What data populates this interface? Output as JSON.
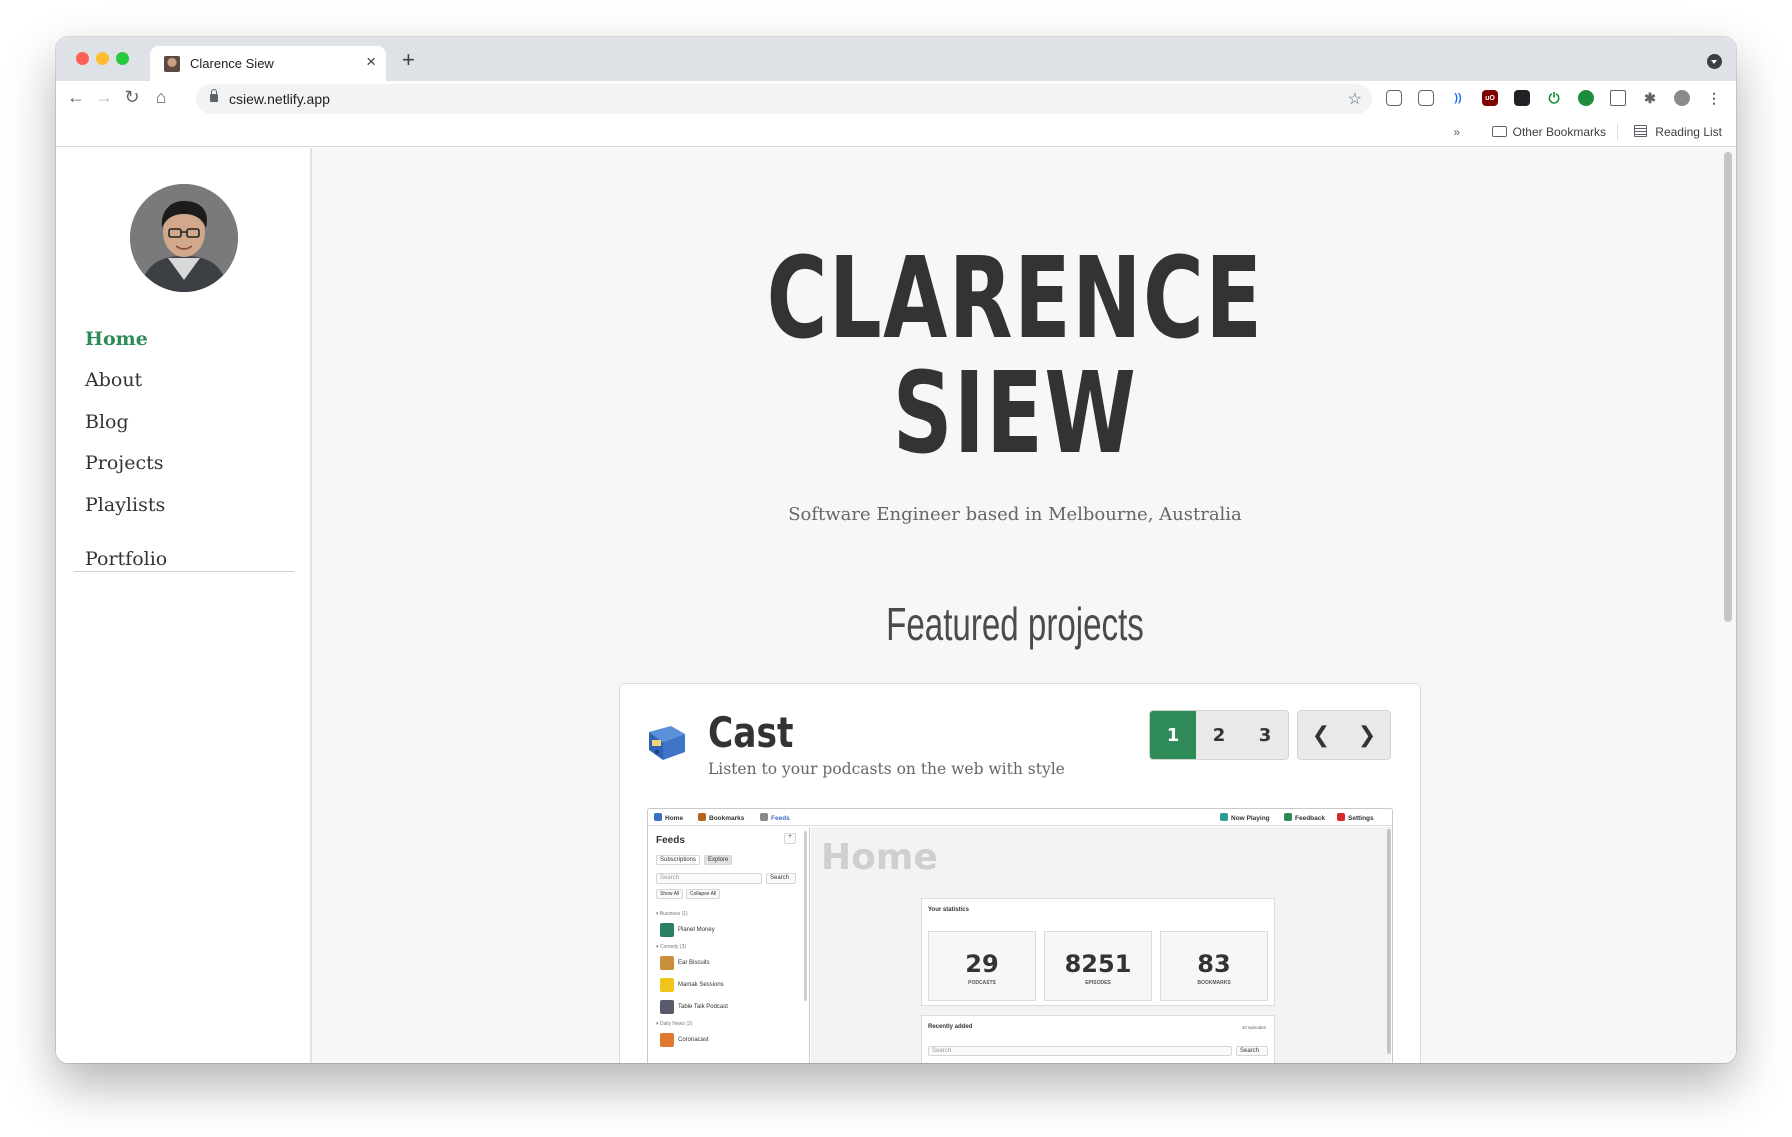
{
  "browser": {
    "tab_title": "Clarence Siew",
    "url": "csiew.netlify.app",
    "bookmarks": {
      "other": "Other Bookmarks",
      "reading_list": "Reading List"
    }
  },
  "sidebar": {
    "items": [
      {
        "label": "Home",
        "active": true
      },
      {
        "label": "About"
      },
      {
        "label": "Blog"
      },
      {
        "label": "Projects"
      },
      {
        "label": "Playlists"
      }
    ],
    "extra": {
      "label": "Portfolio"
    }
  },
  "hero": {
    "name_line1": "CLARENCE",
    "name_line2": "SIEW",
    "tagline": "Software Engineer based in Melbourne, Australia"
  },
  "featured": {
    "title": "Featured projects",
    "project": {
      "name": "Cast",
      "description": "Listen to your podcasts on the web with style",
      "pages": [
        "1",
        "2",
        "3"
      ],
      "active_page": "1",
      "prev_label": "❮",
      "next_label": "❯"
    }
  },
  "screenshot": {
    "nav": {
      "home": "Home",
      "bookmarks": "Bookmarks",
      "feeds": "Feeds",
      "now_playing": "Now Playing",
      "feedback": "Feedback",
      "settings": "Settings"
    },
    "side": {
      "title": "Feeds",
      "add": "+",
      "tab_subscriptions": "Subscriptions",
      "tab_explore": "Explore",
      "search_placeholder": "Search",
      "search_button": "Search",
      "show_all": "Show All",
      "collapse_all": "Collapse All",
      "groups": [
        {
          "label": "▾ Business (1)",
          "feeds": [
            "Planet Money"
          ]
        },
        {
          "label": "▾ Comedy (3)",
          "feeds": [
            "Ear Biscuits",
            "Mamak Sessions",
            "Table Talk Podcast"
          ]
        },
        {
          "label": "▾ Daily News (2)",
          "feeds": [
            "Coronacast"
          ]
        }
      ]
    },
    "main": {
      "heading": "Home",
      "stats_title": "Your statistics",
      "stats": [
        {
          "value": "29",
          "label": "PODCASTS"
        },
        {
          "value": "8251",
          "label": "EPISODES"
        },
        {
          "value": "83",
          "label": "BOOKMARKS"
        }
      ],
      "recent_title": "Recently added",
      "recent_count": "10 episodes",
      "recent_search": "Search",
      "recent_search_button": "Search"
    }
  },
  "colors": {
    "accent": "#2e8b57",
    "text": "#333333"
  }
}
